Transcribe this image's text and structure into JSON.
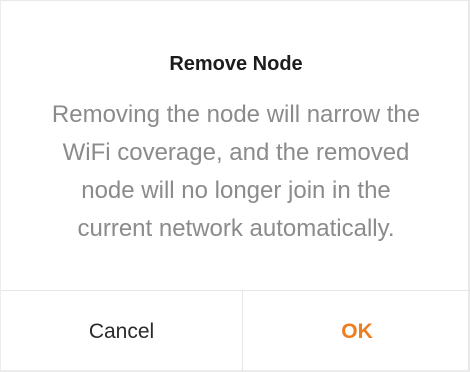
{
  "dialog": {
    "title": "Remove Node",
    "message_lines": [
      "Removing the node will narrow the",
      "WiFi coverage, and the removed",
      "node will no longer join in the",
      "current network automatically."
    ],
    "cancel_label": "Cancel",
    "ok_label": "OK"
  },
  "colors": {
    "accent": "#f07d1d",
    "title_text": "#1c1c1c",
    "body_text": "#8b8b8b",
    "divider": "#e6e6e6"
  }
}
